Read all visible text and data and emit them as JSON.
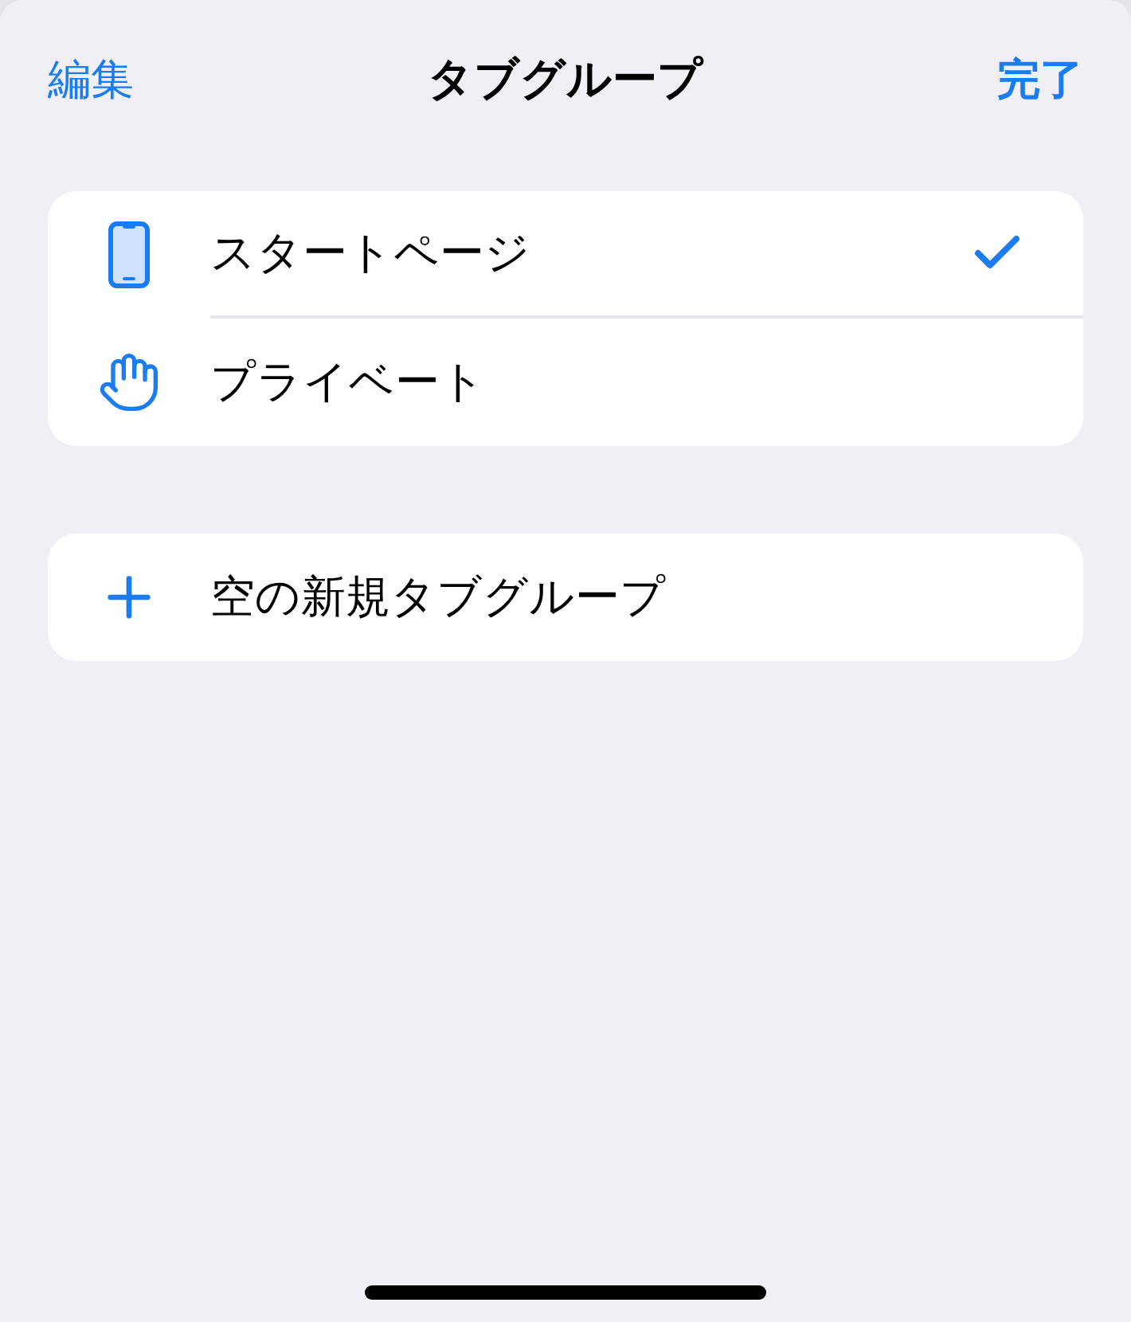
{
  "nav": {
    "left_button": "編集",
    "title": "タブグループ",
    "right_button": "完了"
  },
  "groups": [
    {
      "items": [
        {
          "kind": "phone",
          "label": "スタートページ",
          "selected": true
        },
        {
          "kind": "hand",
          "label": "プライベート",
          "selected": false
        }
      ]
    },
    {
      "items": [
        {
          "kind": "add",
          "label": "空の新規タブグループ"
        }
      ]
    }
  ]
}
